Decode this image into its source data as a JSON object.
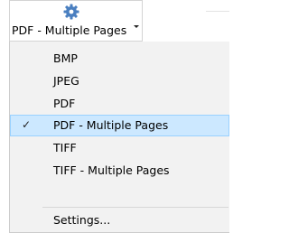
{
  "split_button": {
    "label": "PDF - Multiple Pages",
    "icon": "gear-icon",
    "arrow_icon": "chevron-down-icon"
  },
  "menu": {
    "items": [
      {
        "label": "BMP",
        "checked": false
      },
      {
        "label": "JPEG",
        "checked": false
      },
      {
        "label": "PDF",
        "checked": false
      },
      {
        "label": "PDF - Multiple Pages",
        "checked": true
      },
      {
        "label": "TIFF",
        "checked": false
      },
      {
        "label": "TIFF - Multiple Pages",
        "checked": false
      }
    ],
    "settings_label": "Settings...",
    "check_glyph": "✓"
  },
  "colors": {
    "selected_bg": "#cce8ff",
    "selected_border": "#99d1ff",
    "menu_bg": "#f2f2f2",
    "gear": "#4a7fc0"
  }
}
